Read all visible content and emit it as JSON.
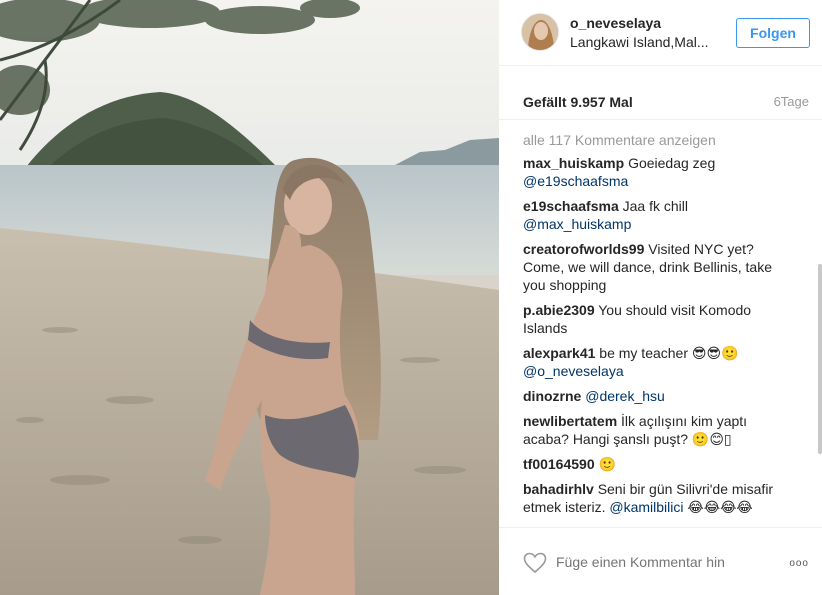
{
  "post": {
    "username": "o_neveselaya",
    "location": "Langkawi Island,Mal...",
    "follow_label": "Folgen",
    "likes": "Gefällt 9.957 Mal",
    "age": "6Tage",
    "view_all": "alle 117 Kommentare anzeigen"
  },
  "comments": [
    {
      "user": "max_huiskamp",
      "text": "Goeiedag zeg",
      "mention": "@e19schaafsma",
      "after": ""
    },
    {
      "user": "e19schaafsma",
      "text": "Jaa fk chill",
      "mention": "@max_huiskamp",
      "after": ""
    },
    {
      "user": "creatorofworlds99",
      "text": "Visited NYC yet? Come, we will dance, drink Bellinis, take you shopping",
      "mention": "",
      "after": ""
    },
    {
      "user": "p.abie2309",
      "text": "You should visit Komodo Islands",
      "mention": "",
      "after": ""
    },
    {
      "user": "alexpark41",
      "text": "be my teacher 😎😎🙂",
      "mention": "@o_neveselaya",
      "after": ""
    },
    {
      "user": "dinozrne",
      "text": "",
      "mention": "@derek_hsu",
      "after": ""
    },
    {
      "user": "newlibertatem",
      "text": "İlk açılışını kim yaptı acaba? Hangi şanslı puşt? 🙂😊▯",
      "mention": "",
      "after": ""
    },
    {
      "user": "tf00164590",
      "text": "🙂",
      "mention": "",
      "after": ""
    },
    {
      "user": "bahadirhlv",
      "text": "Seni bir gün Silivri'de misafir etmek isteriz.",
      "mention": "@kamilbilici",
      "after": "😂😂😂😂"
    }
  ],
  "footer": {
    "comment_placeholder": "Füge einen Kommentar hin",
    "more_label": "ooo"
  },
  "colors": {
    "link": "#003569",
    "accent": "#3897f0",
    "muted": "#999999"
  },
  "icons": {
    "heart": "heart-outline-icon",
    "more": "more-options-icon"
  }
}
